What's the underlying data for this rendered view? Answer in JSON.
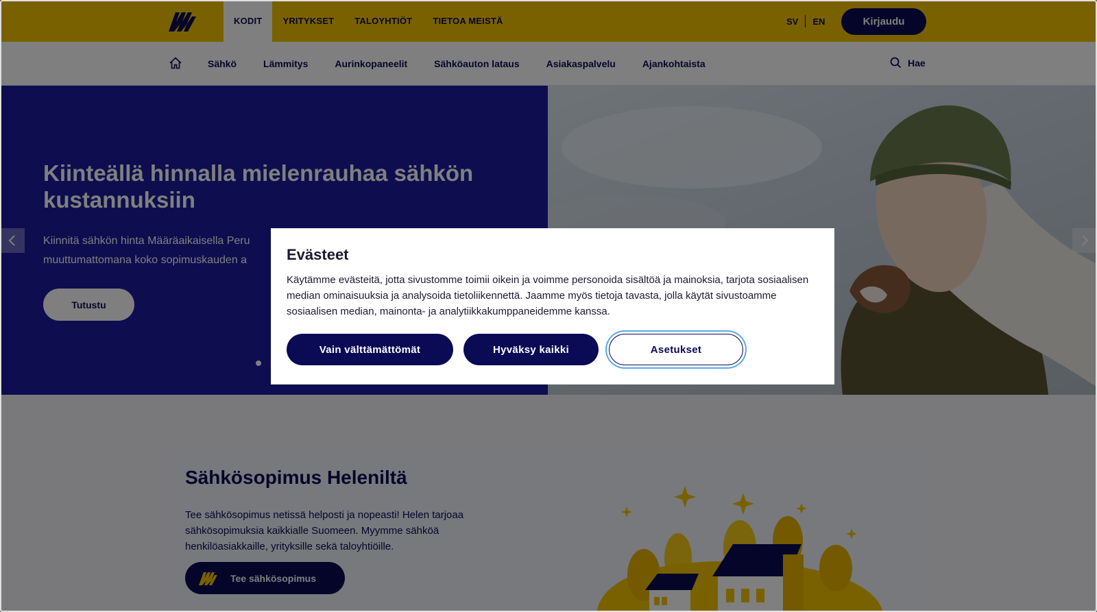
{
  "topbar": {
    "logo_icon": "helen-lightning-logo-icon",
    "nav": [
      "KODIT",
      "YRITYKSET",
      "TALOYHTIÖT",
      "TIETOA MEISTÄ"
    ],
    "active_nav": "KODIT",
    "lang": [
      "SV",
      "EN"
    ],
    "login_label": "Kirjaudu",
    "colors": {
      "bar": "#f5c300",
      "navy": "#0a0a55"
    }
  },
  "subnav": {
    "home_icon": "home-icon",
    "items": [
      "Sähkö",
      "Lämmitys",
      "Aurinkopaneelit",
      "Sähköauton lataus",
      "Asiakaspalvelu",
      "Ajankohtaista"
    ],
    "search_icon": "search-icon",
    "search_label": "Hae"
  },
  "hero": {
    "title": "Kiinteällä hinnalla mielenrauhaa sähkön kustannuksiin",
    "text_line1": "Kiinnitä sähkön hinta Määräaikaisella Peru",
    "text_line2": "muuttumattomana koko sopimuskauden a",
    "button_label": "Tutustu",
    "prev_icon": "chevron-left-icon",
    "next_icon": "chevron-right-icon",
    "background": "#1b1a9e"
  },
  "card": {
    "title": "Sähkösopimus Heleniltä",
    "text": "Tee sähkösopimus netissä helposti ja nopeasti! Helen tarjoaa sähkösopimuksia kaikkialle Suomeen. Myymme sähköä henkilöasiakkaille, yrityksille sekä taloyhtiöille.",
    "button_label": "Tee sähkösopimus",
    "button_icon": "helen-lightning-icon",
    "illustration": "houses-illustration"
  },
  "cookie_modal": {
    "title": "Evästeet",
    "text": "Käytämme evästeitä, jotta sivustomme toimii oikein ja voimme personoida sisältöä ja mainoksia, tarjota sosiaalisen median ominaisuuksia ja analysoida tietoliikennettä. Jaamme myös tietoja tavasta, jolla käytät sivustoamme sosiaalisen median, mainonta- ja analytiikkakumppaneidemme kanssa.",
    "buttons": {
      "necessary": "Vain välttämättömät",
      "accept_all": "Hyväksy kaikki",
      "settings": "Asetukset"
    }
  }
}
